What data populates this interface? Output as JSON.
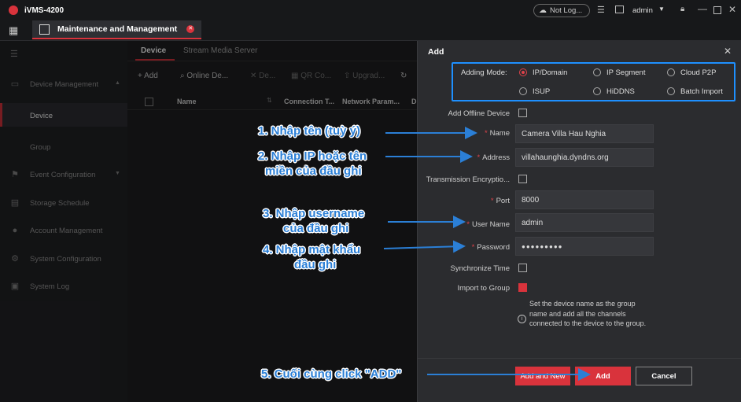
{
  "app": {
    "title": "iVMS-4200",
    "cloud_status": "Not Log...",
    "user": "admin"
  },
  "tab": {
    "label": "Maintenance and Management"
  },
  "sidebar": {
    "items": [
      {
        "label": "Device Management",
        "icon": "device-icon"
      },
      {
        "label": "Device",
        "icon": ""
      },
      {
        "label": "Group",
        "icon": ""
      },
      {
        "label": "Event Configuration",
        "icon": "event-icon"
      },
      {
        "label": "Storage Schedule",
        "icon": "storage-icon"
      },
      {
        "label": "Account Management",
        "icon": "account-icon"
      },
      {
        "label": "System Configuration",
        "icon": "config-icon"
      },
      {
        "label": "System Log",
        "icon": "log-icon"
      }
    ]
  },
  "main": {
    "tabs": [
      "Device",
      "Stream Media Server"
    ],
    "toolbar": {
      "add": "Add",
      "online": "Online De...",
      "delete": "De...",
      "qr": "QR Co...",
      "upgrade": "Upgrad..."
    },
    "columns": [
      "Name",
      "Connection T...",
      "Network Param...",
      "D"
    ]
  },
  "dialog": {
    "title": "Add",
    "adding_mode_label": "Adding Mode:",
    "modes": [
      "IP/Domain",
      "IP Segment",
      "Cloud P2P",
      "ISUP",
      "HiDDNS",
      "Batch Import"
    ],
    "selected_mode": "IP/Domain",
    "add_offline_label": "Add Offline Device",
    "fields": {
      "name": {
        "label": "Name",
        "value": "Camera Villa Hau Nghia"
      },
      "address": {
        "label": "Address",
        "value": "villahaunghia.dyndns.org"
      },
      "transmission": {
        "label": "Transmission Encryptio..."
      },
      "port": {
        "label": "Port",
        "value": "8000"
      },
      "username": {
        "label": "User Name",
        "value": "admin"
      },
      "password": {
        "label": "Password",
        "value": "●●●●●●●●●"
      },
      "sync": {
        "label": "Synchronize Time"
      },
      "import": {
        "label": "Import to Group"
      }
    },
    "import_hint": "Set the device name as the group name and add all the channels connected to the device to the group.",
    "buttons": {
      "add_new": "Add and New",
      "add": "Add",
      "cancel": "Cancel"
    }
  },
  "annotations": [
    "1. Nhập tên (tuỳ ý)",
    "2. Nhập IP hoặc tên",
    "miền của đầu ghi",
    "3. Nhập username",
    "của đầu ghi",
    "4. Nhập mật khẩu",
    "đầu ghi",
    "5. Cuối cùng click \"ADD\""
  ],
  "colors": {
    "accent": "#e0424a",
    "annotation": "#2b7fd6",
    "highlight_box": "#1e90ff"
  }
}
